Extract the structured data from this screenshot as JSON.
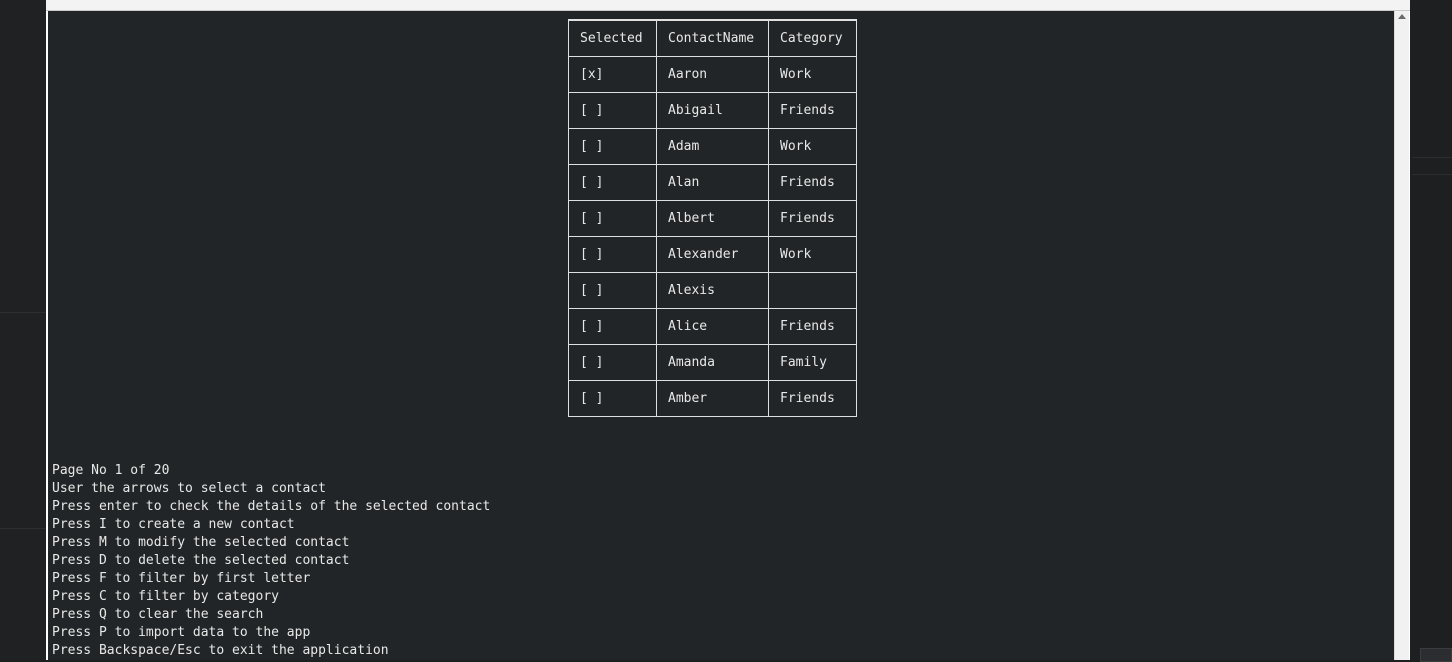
{
  "table": {
    "headers": [
      "Selected",
      "ContactName",
      "Category"
    ],
    "rows": [
      {
        "selected": "[x]",
        "name": "Aaron",
        "category": "Work"
      },
      {
        "selected": "[ ]",
        "name": "Abigail",
        "category": "Friends"
      },
      {
        "selected": "[ ]",
        "name": "Adam",
        "category": "Work"
      },
      {
        "selected": "[ ]",
        "name": "Alan",
        "category": "Friends"
      },
      {
        "selected": "[ ]",
        "name": "Albert",
        "category": "Friends"
      },
      {
        "selected": "[ ]",
        "name": "Alexander",
        "category": "Work"
      },
      {
        "selected": "[ ]",
        "name": "Alexis",
        "category": ""
      },
      {
        "selected": "[ ]",
        "name": "Alice",
        "category": "Friends"
      },
      {
        "selected": "[ ]",
        "name": "Amanda",
        "category": "Family"
      },
      {
        "selected": "[ ]",
        "name": "Amber",
        "category": "Friends"
      }
    ]
  },
  "help": {
    "page_info": "Page No 1 of 20",
    "lines": [
      "User the arrows to select a contact",
      "Press enter to check the details of the selected contact",
      "Press I to create a new contact",
      "Press M to modify the selected contact",
      "Press D to delete the selected contact",
      "Press F to filter by first letter",
      "Press C to filter by category",
      "Press Q to clear the search",
      "Press P to import data to the app",
      "Press Backspace/Esc to exit the application"
    ]
  },
  "colors": {
    "terminal_bg": "#222527",
    "text": "#e8e8e8",
    "border": "#e0e0e0"
  }
}
